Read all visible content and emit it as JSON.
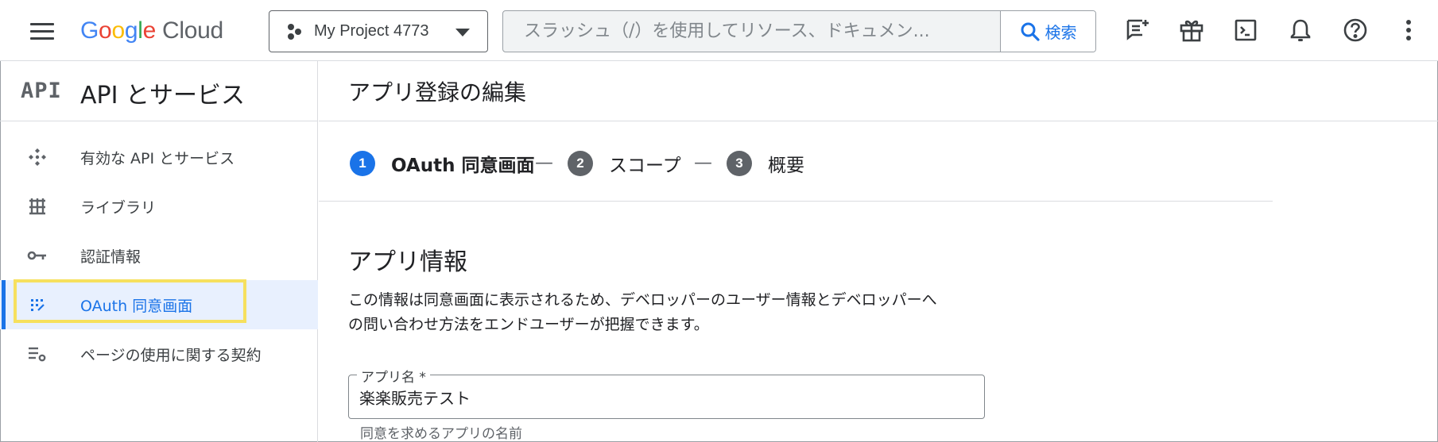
{
  "topbar": {
    "logo_word": [
      "G",
      "o",
      "o",
      "g",
      "l",
      "e"
    ],
    "logo_product": "Cloud",
    "project_label": "My Project 4773",
    "search_placeholder": "スラッシュ（/）を使用してリソース、ドキュメン...",
    "search_button_label": "検索",
    "icons": [
      "menu-icon",
      "project-icon",
      "search-icon",
      "notes-icon",
      "gift-icon",
      "terminal-icon",
      "bell-icon",
      "help-icon",
      "more-vert-icon"
    ]
  },
  "sidebar": {
    "logo_text": "API",
    "title": "API とサービス",
    "items": [
      {
        "label": "有効な API とサービス",
        "icon": "api-enabled-icon"
      },
      {
        "label": "ライブラリ",
        "icon": "library-icon"
      },
      {
        "label": "認証情報",
        "icon": "key-icon"
      },
      {
        "label": "OAuth 同意画面",
        "icon": "oauth-consent-icon",
        "active": true
      },
      {
        "label": "ページの使用に関する契約",
        "icon": "agreements-icon"
      }
    ]
  },
  "main": {
    "page_title": "アプリ登録の編集",
    "steps": [
      {
        "num": "1",
        "label": "OAuth 同意画面",
        "active": true
      },
      {
        "num": "2",
        "label": "スコープ"
      },
      {
        "num": "3",
        "label": "概要"
      }
    ],
    "step_separator": "—",
    "section_title": "アプリ情報",
    "section_desc_line1": "この情報は同意画面に表示されるため、デベロッパーのユーザー情報とデベロッパーへ",
    "section_desc_line2": "の問い合わせ方法をエンドユーザーが把握できます。",
    "app_name_field": {
      "label": "アプリ名 *",
      "value": "楽楽販売テスト",
      "hint": "同意を求めるアプリの名前"
    }
  },
  "colors": {
    "accent": "#1a73e8",
    "highlight": "#f6e05e",
    "active_bg": "#e8f0fe",
    "step_inactive": "#5f6368"
  }
}
